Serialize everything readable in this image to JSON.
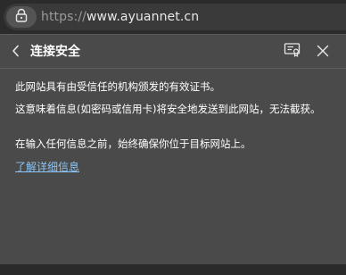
{
  "address_bar": {
    "url_scheme": "https://",
    "url_host": "www.ayuannet.cn",
    "lock_icon": "lock-icon"
  },
  "security_panel": {
    "title": "连接安全",
    "back_icon": "chevron-left-icon",
    "certificate_icon": "certificate-icon",
    "close_icon": "close-icon",
    "message_1": "此网站具有由受信任的机构颁发的有效证书。",
    "message_2": "这意味着信息(如密码或信用卡)将安全地发送到此网站，无法截获。",
    "message_3": "在输入任何信息之前，始终确保你位于目标网站上。",
    "learn_more_link": "了解详细信息",
    "link_color": "#8cc4f5",
    "panel_background": "#4a4a4a"
  }
}
